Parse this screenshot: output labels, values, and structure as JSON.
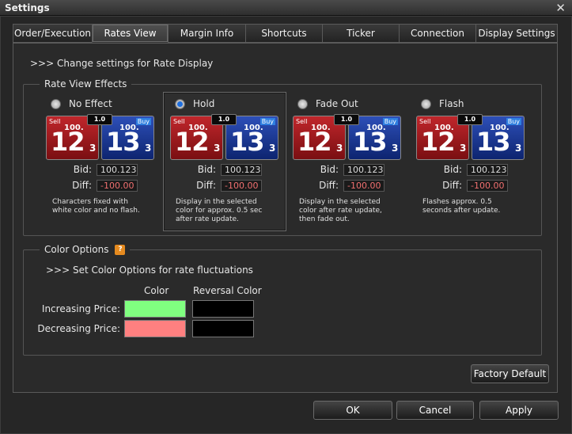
{
  "window": {
    "title": "Settings"
  },
  "tabs": [
    {
      "label": "Order/Execution"
    },
    {
      "label": "Rates View",
      "active": true
    },
    {
      "label": "Margin Info"
    },
    {
      "label": "Shortcuts"
    },
    {
      "label": "Ticker"
    },
    {
      "label": "Connection"
    },
    {
      "label": "Display Settings"
    }
  ],
  "header": {
    "text": ">>> Change settings for Rate Display"
  },
  "rate_view_effects": {
    "legend": "Rate View Effects",
    "selected": "Hold",
    "effects": [
      {
        "name": "No Effect",
        "desc_line1": "Characters fixed with",
        "desc_line2": "white color and no flash.",
        "desc_line3": ""
      },
      {
        "name": "Hold",
        "desc_line1": "Display in the selected",
        "desc_line2": "color for approx. 0.5 sec",
        "desc_line3": "after rate update."
      },
      {
        "name": "Fade Out",
        "desc_line1": "Display in the selected",
        "desc_line2": "color after rate update,",
        "desc_line3": "then fade out."
      },
      {
        "name": "Flash",
        "desc_line1": "Flashes approx. 0.5",
        "desc_line2": "seconds after update.",
        "desc_line3": ""
      }
    ],
    "quote": {
      "sell_label": "Sell",
      "buy_label": "Buy",
      "spread": "1.0",
      "sell_prefix": "100.",
      "sell_big": "12",
      "sell_small": "3",
      "buy_prefix": "100.",
      "buy_big": "13",
      "buy_small": "3"
    },
    "bid_label": "Bid:",
    "bid_value": "100.123",
    "diff_label": "Diff:",
    "diff_value": "-100.00"
  },
  "color_options": {
    "legend": "Color Options",
    "help": "?",
    "subheader": ">>> Set Color Options for rate fluctuations",
    "col_color": "Color",
    "col_reversal": "Reversal Color",
    "rows": [
      {
        "label": "Increasing Price:",
        "color": "#80ff80",
        "reversal": "#000000"
      },
      {
        "label": "Decreasing Price:",
        "color": "#ff8080",
        "reversal": "#000000"
      }
    ]
  },
  "buttons": {
    "factory_default": "Factory Default",
    "ok": "OK",
    "cancel": "Cancel",
    "apply": "Apply"
  }
}
